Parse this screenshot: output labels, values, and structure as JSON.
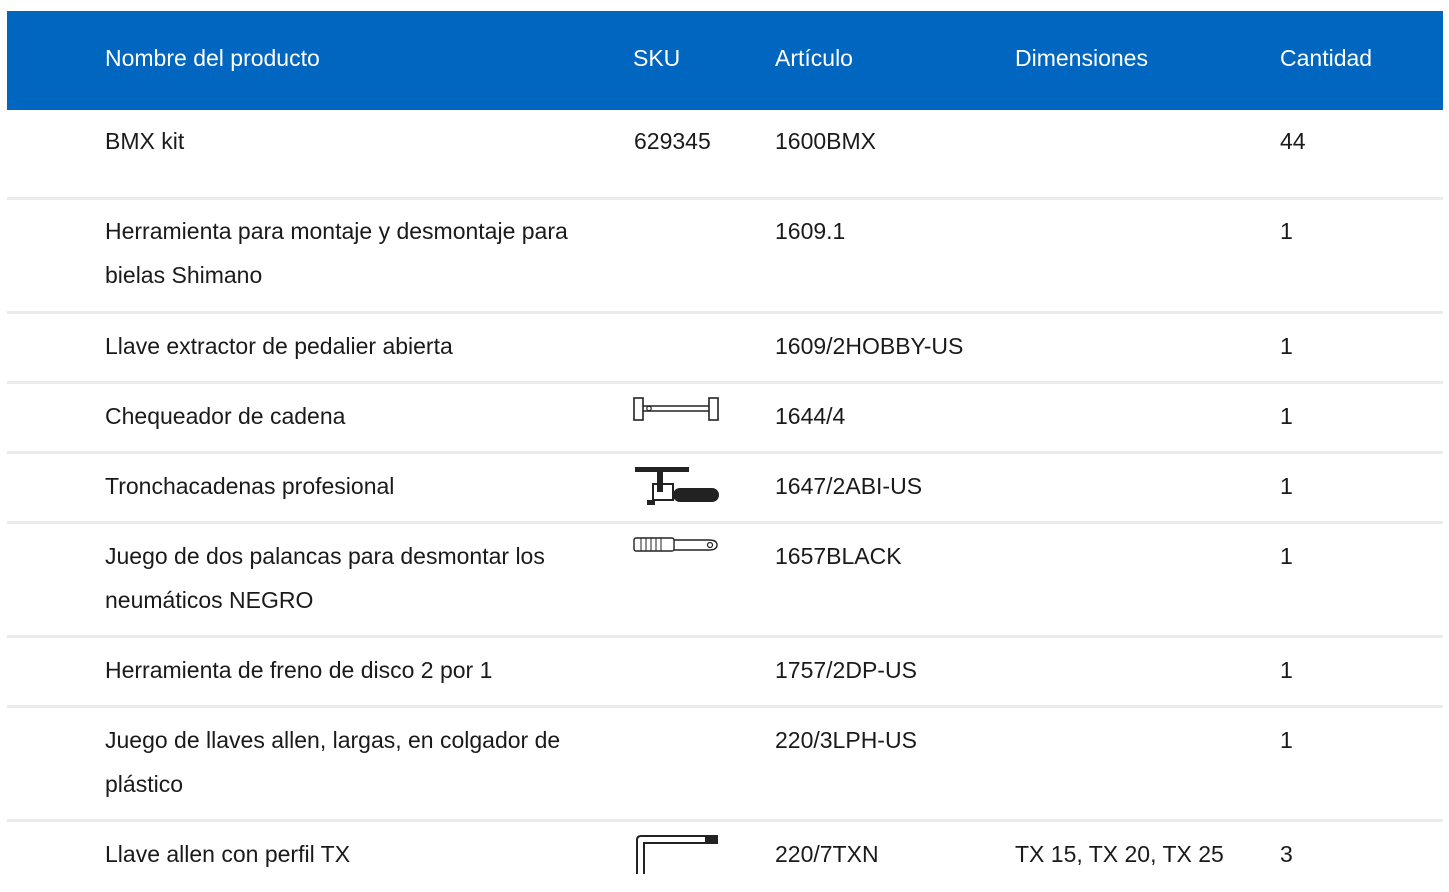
{
  "table": {
    "headers": {
      "name": "Nombre del producto",
      "sku": "SKU",
      "article": "Artículo",
      "dimensions": "Dimensiones",
      "quantity": "Cantidad"
    },
    "rows": [
      {
        "name": "BMX kit",
        "sku": "629345",
        "article": "1600BMX",
        "dimensions": "",
        "quantity": "44",
        "icon": ""
      },
      {
        "name": "Herramienta para montaje y desmontaje para bielas Shimano",
        "sku": "",
        "article": "1609.1",
        "dimensions": "",
        "quantity": "1",
        "icon": ""
      },
      {
        "name": "Llave extractor de pedalier abierta",
        "sku": "",
        "article": "1609/2HOBBY-US",
        "dimensions": "",
        "quantity": "1",
        "icon": ""
      },
      {
        "name": "Chequeador de cadena",
        "sku": "",
        "article": "1644/4",
        "dimensions": "",
        "quantity": "1",
        "icon": "chain-checker-icon"
      },
      {
        "name": "Tronchacadenas profesional",
        "sku": "",
        "article": "1647/2ABI-US",
        "dimensions": "",
        "quantity": "1",
        "icon": "chain-breaker-icon"
      },
      {
        "name": "Juego de dos palancas para desmontar los neumáticos NEGRO",
        "sku": "",
        "article": "1657BLACK",
        "dimensions": "",
        "quantity": "1",
        "icon": "tire-lever-icon"
      },
      {
        "name": "Herramienta de freno de disco 2 por 1",
        "sku": "",
        "article": "1757/2DP-US",
        "dimensions": "",
        "quantity": "1",
        "icon": ""
      },
      {
        "name": "Juego de llaves allen, largas, en colgador de plástico",
        "sku": "",
        "article": "220/3LPH-US",
        "dimensions": "",
        "quantity": "1",
        "icon": ""
      },
      {
        "name": "Llave allen con perfil TX",
        "sku": "",
        "article": "220/7TXN",
        "dimensions": "TX 15, TX 20, TX 25",
        "quantity": "3",
        "icon": "allen-key-icon"
      }
    ]
  }
}
